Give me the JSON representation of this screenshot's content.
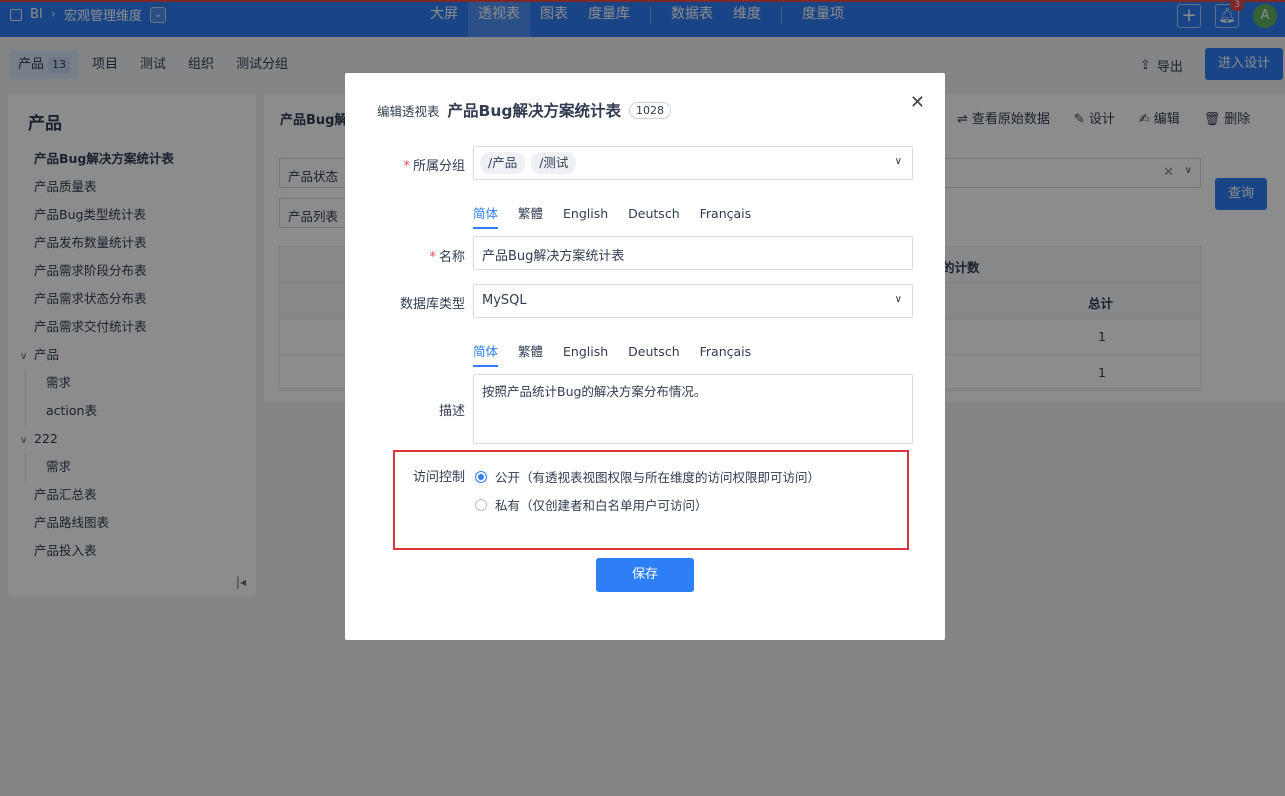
{
  "topbar": {
    "app": "BI",
    "dimension": "宏观管理维度",
    "nav": [
      "大屏",
      "透视表",
      "图表",
      "度量库",
      "数据表",
      "维度",
      "度量项"
    ],
    "active_nav": "透视表",
    "notify_count": "3",
    "avatar": "A"
  },
  "subbar": {
    "tabs": [
      {
        "label": "产品",
        "count": "13"
      },
      {
        "label": "项目"
      },
      {
        "label": "测试"
      },
      {
        "label": "组织"
      },
      {
        "label": "测试分组"
      }
    ],
    "export": "导出",
    "enter_design": "进入设计"
  },
  "sidebar": {
    "title": "产品",
    "items": [
      "产品Bug解决方案统计表",
      "产品质量表",
      "产品Bug类型统计表",
      "产品发布数量统计表",
      "产品需求阶段分布表",
      "产品需求状态分布表",
      "产品需求交付统计表",
      "产品",
      "需求",
      "action表",
      "222",
      "需求",
      "产品汇总表",
      "产品路线图表",
      "产品投入表"
    ]
  },
  "main": {
    "title": "产品Bug解",
    "actions": [
      "查看原始数据",
      "设计",
      "编辑",
      "删除"
    ],
    "filter1": "产品状态",
    "filter2": "产品列表",
    "query": "查询",
    "table_header1": "的计数",
    "table_header2": "总计",
    "rows": [
      "1",
      "1"
    ]
  },
  "modal": {
    "prefix": "编辑透视表",
    "name": "产品Bug解决方案统计表",
    "id": "1028",
    "group_label": "所属分组",
    "group_tags": [
      "/产品",
      "/测试"
    ],
    "lang_tabs": [
      "简体",
      "繁體",
      "English",
      "Deutsch",
      "Français"
    ],
    "name_label": "名称",
    "name_value": "产品Bug解决方案统计表",
    "db_label": "数据库类型",
    "db_value": "MySQL",
    "desc_label": "描述",
    "desc_value": "按照产品统计Bug的解决方案分布情况。",
    "access_label": "访问控制",
    "access_public": "公开（有透视表视图权限与所在维度的访问权限即可访问）",
    "access_private": "私有（仅创建者和白名单用户可访问）",
    "save": "保存"
  }
}
